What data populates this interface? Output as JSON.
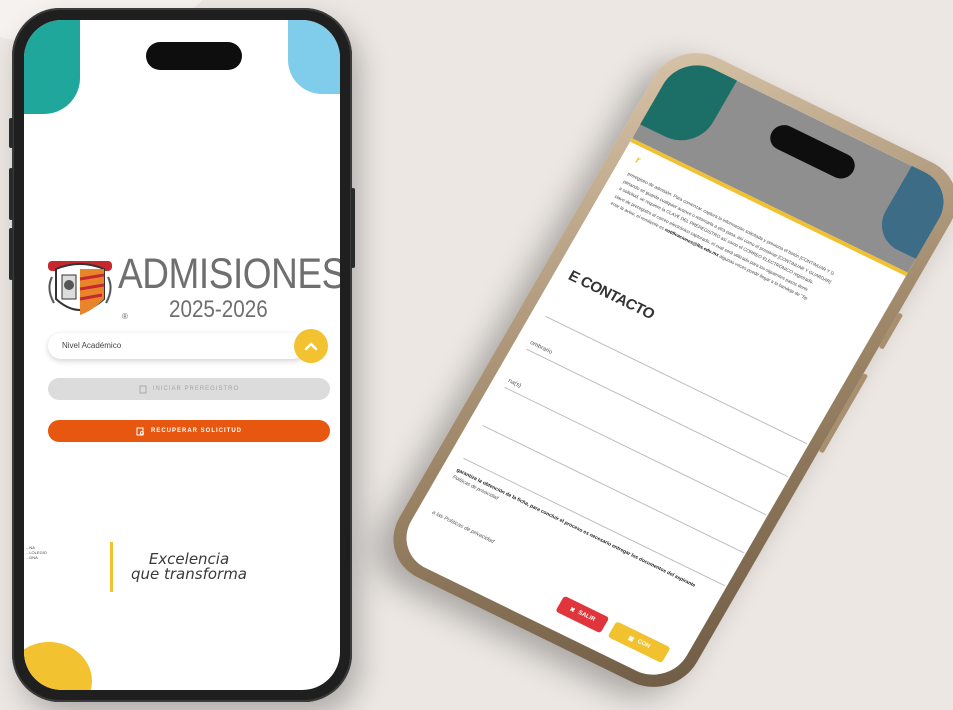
{
  "left_phone": {
    "title": "ADMISIONES",
    "year": "2025-2026",
    "trademark": "®",
    "select": {
      "placeholder": "Nivel Académico"
    },
    "btn_start": "INICIAR PREREGISTRO",
    "btn_recover": "RECUPERAR SOLICITUD",
    "institution_text": "...NA\n...LOLEGIO\n...DNA",
    "slogan_line1": "Excelencia",
    "slogan_line2": "que transforma"
  },
  "right_phone": {
    "heading": "r",
    "paragraph_1": "preregistro de admisión. Para comenzar, captura la información solicitada y presiona el botón [CONTINUAR Y G",
    "paragraph_2": "pletando se guarda cualquier avance o retomarla a otra pasa, así como el presionar [CONTINUAR Y GUARDAR]",
    "paragraph_3": "a solicitud, se requiere la CLAVE DEL PREREGISTRO así como el CORREO ELECTRÓNICO registrado.",
    "paragraph_4": "clave de preregistro al correo electrónico capturado, el cual será utilizado para los siguientes pasos dentr",
    "paragraph_5": "enar la aviso, el remitente es",
    "paragraph_5_email": "notificaciones@lbs.edu.mx",
    "paragraph_5_tail": "algunas veces puede llegar a la bandeja de \"Sp",
    "section_title": "E CONTACTO",
    "field_1": "",
    "field_2": "ombrario",
    "field_3": "na(s)",
    "field_4": "",
    "field_5": "",
    "consent": "garantiza la obtención de la ficha, para concluir el proceso es necesario entregar los documentos del aspirante",
    "consent_sub": "Políticas de privacidad",
    "privacy": "a las Políticas de privacidad",
    "btn_exit": "SALIR",
    "btn_continue": "CON"
  },
  "colors": {
    "teal": "#1ea79a",
    "sky": "#7fcdea",
    "yellow": "#f2c230",
    "orange": "#e8570f",
    "red": "#e0353c",
    "background": "#ece7e3"
  }
}
